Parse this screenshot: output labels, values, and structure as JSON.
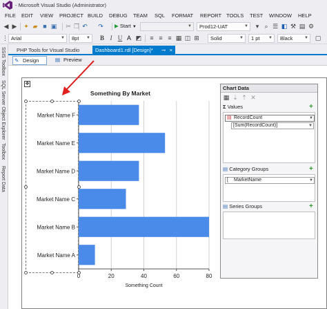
{
  "window": {
    "title": "- Microsoft Visual Studio (Administrator)"
  },
  "menu": [
    "FILE",
    "EDIT",
    "VIEW",
    "PROJECT",
    "BUILD",
    "DEBUG",
    "TEAM",
    "SQL",
    "FORMAT",
    "REPORT",
    "TOOLS",
    "TEST",
    "WINDOW",
    "HELP"
  ],
  "toolbar1": {
    "start_label": "Start",
    "config_value": "Prod12-UAT"
  },
  "toolbar2": {
    "font_value": "Arial",
    "size_value": "8pt",
    "bold": "B",
    "italic": "I",
    "underline": "U",
    "line_style": "Solid",
    "line_width": "1 pt",
    "line_color": "Black"
  },
  "left_tabs": [
    "SSIS Toolbox",
    "SQL Server Object Explorer",
    "Toolbox",
    "Report Data"
  ],
  "doc_tabs": {
    "inactive": "PHP Tools for Visual Studio",
    "active": "Dashboard1.rdl [Design]*"
  },
  "view_buttons": {
    "design": "Design",
    "preview": "Preview"
  },
  "chart_data": {
    "type": "bar",
    "orientation": "horizontal",
    "title": "Something By Market",
    "xlabel": "Something Count",
    "ylabel": "",
    "categories": [
      "Market Name A",
      "Market Name B",
      "Market Name C",
      "Market Name D",
      "Market Name E",
      "Market Name F"
    ],
    "values": [
      10,
      80,
      29,
      37,
      53,
      37
    ],
    "xlim": [
      0,
      80
    ],
    "xticks": [
      "0",
      "20",
      "40",
      "60",
      "80"
    ],
    "bar_color": "#4a8ae8",
    "grid": true
  },
  "chart_data_panel": {
    "title": "Chart Data",
    "values_header": "Values",
    "values_field": "RecordCount",
    "values_expr": "[Sum(RecordCount)]",
    "category_header": "Category Groups",
    "category_field": "MarketName",
    "series_header": "Series Groups"
  },
  "colors": {
    "accent": "#007acc",
    "arrow": "#e02020"
  }
}
